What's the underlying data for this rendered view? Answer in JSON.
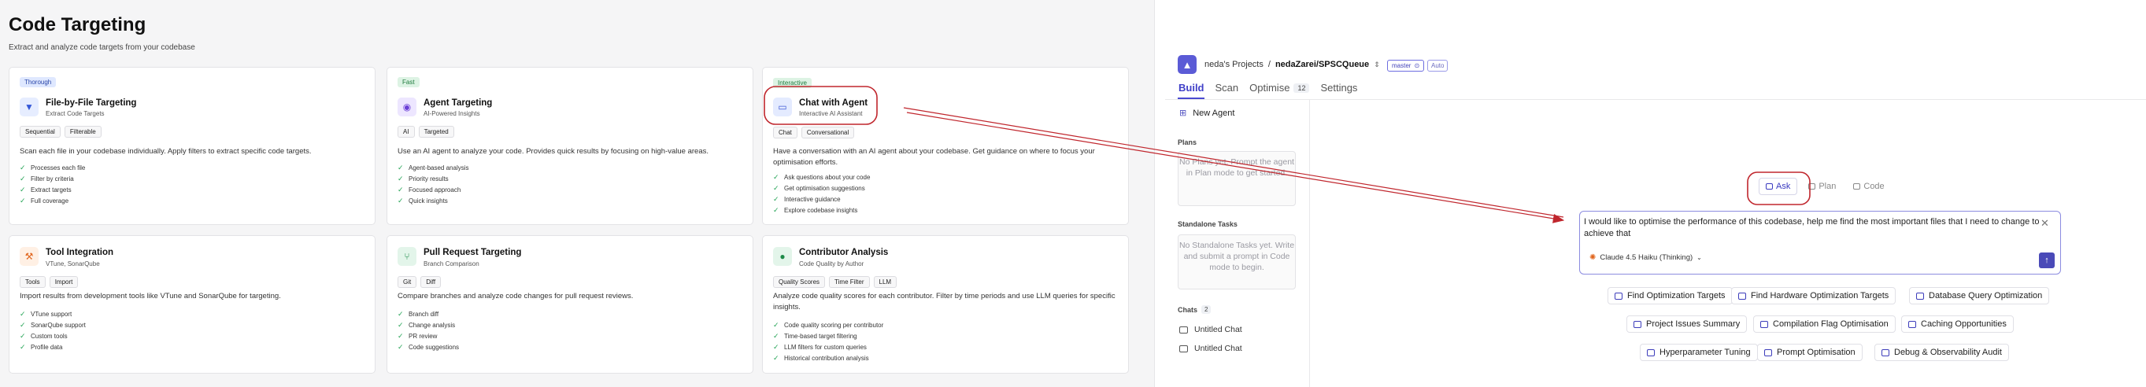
{
  "left": {
    "title": "Code Targeting",
    "subtitle": "Extract and analyze code targets from your codebase",
    "cards": [
      {
        "tag": "Thorough",
        "title": "File-by-File Targeting",
        "sub": "Extract Code Targets",
        "chips": [
          "Sequential",
          "Filterable"
        ],
        "desc": "Scan each file in your codebase individually. Apply filters to extract specific code targets.",
        "items": [
          "Processes each file",
          "Filter by criteria",
          "Extract targets",
          "Full coverage"
        ]
      },
      {
        "tag": "Fast",
        "title": "Agent Targeting",
        "sub": "AI-Powered Insights",
        "chips": [
          "AI",
          "Targeted"
        ],
        "desc": "Use an AI agent to analyze your code. Provides quick results by focusing on high-value areas.",
        "items": [
          "Agent-based analysis",
          "Priority results",
          "Focused approach",
          "Quick insights"
        ]
      },
      {
        "tag": "Interactive",
        "title": "Chat with Agent",
        "sub": "Interactive AI Assistant",
        "chips": [
          "Chat",
          "Conversational"
        ],
        "desc": "Have a conversation with an AI agent about your codebase. Get guidance on where to focus your optimisation efforts.",
        "items": [
          "Ask questions about your code",
          "Get optimisation suggestions",
          "Interactive guidance",
          "Explore codebase insights"
        ]
      },
      {
        "tag": "",
        "title": "Tool Integration",
        "sub": "VTune, SonarQube",
        "chips": [
          "Tools",
          "Import"
        ],
        "desc": "Import results from development tools like VTune and SonarQube for targeting.",
        "items": [
          "VTune support",
          "SonarQube support",
          "Custom tools",
          "Profile data"
        ]
      },
      {
        "tag": "",
        "title": "Pull Request Targeting",
        "sub": "Branch Comparison",
        "chips": [
          "Git",
          "Diff"
        ],
        "desc": "Compare branches and analyze code changes for pull request reviews.",
        "items": [
          "Branch diff",
          "Change analysis",
          "PR review",
          "Code suggestions"
        ]
      },
      {
        "tag": "",
        "title": "Contributor Analysis",
        "sub": "Code Quality by Author",
        "chips": [
          "Quality Scores",
          "Time Filter",
          "LLM"
        ],
        "desc": "Analyze code quality scores for each contributor. Filter by time periods and use LLM queries for specific insights.",
        "items": [
          "Code quality scoring per contributor",
          "Time-based target filtering",
          "LLM filters for custom queries",
          "Historical contribution analysis"
        ]
      }
    ]
  },
  "right": {
    "project_owner": "neda's Projects",
    "separator": "/",
    "repo": "nedaZarei/SPSCQueue",
    "branch": "master",
    "branch_mode": "Auto",
    "tabs": [
      {
        "label": "Build",
        "badge": ""
      },
      {
        "label": "Scan",
        "badge": ""
      },
      {
        "label": "Optimise",
        "badge": "12"
      },
      {
        "label": "Settings",
        "badge": ""
      }
    ],
    "new_agent": "New Agent",
    "plans_label": "Plans",
    "plans_empty": "No Plans yet. Prompt the agent in Plan mode to get started.",
    "standalone_label": "Standalone Tasks",
    "standalone_empty": "No Standalone Tasks yet. Write and submit a prompt in Code mode to begin.",
    "chats_label": "Chats",
    "chats_count": "2",
    "chats": [
      "Untitled Chat",
      "Untitled Chat"
    ],
    "modes": [
      "Ask",
      "Plan",
      "Code"
    ],
    "prompt": "I would like to optimise the performance of this codebase, help me find the most important files that I need to change to achieve that",
    "model": "Claude 4.5 Haiku (Thinking)",
    "suggestions_row1": [
      "Find Optimization Targets",
      "Find Hardware Optimization Targets",
      "Database Query Optimization"
    ],
    "suggestions_row2": [
      "Project Issues Summary",
      "Compilation Flag Optimisation",
      "Caching Opportunities"
    ],
    "suggestions_row3": [
      "Hyperparameter Tuning",
      "Prompt Optimisation",
      "Debug & Observability Audit"
    ]
  },
  "colors": {
    "accent": "#4a4ad0",
    "annotation": "#c0262d",
    "check": "#23a455"
  }
}
